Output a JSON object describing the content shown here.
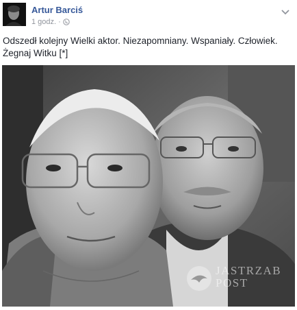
{
  "post": {
    "author": "Artur Barciś",
    "timestamp": "1 godz.",
    "separator": "·",
    "privacy_icon": "globe-icon",
    "menu_icon": "chevron-down-icon",
    "text_line1": "Odszedł kolejny Wielki aktor. Niezapomniany. Wspaniały. Człowiek.",
    "text_line2": "Żegnaj Witku [*]"
  },
  "photo": {
    "watermark_line1": "JASTRZAB",
    "watermark_line2": "POST"
  },
  "colors": {
    "author_link": "#365899",
    "meta_text": "#90949c",
    "body_text": "#1d2129"
  }
}
